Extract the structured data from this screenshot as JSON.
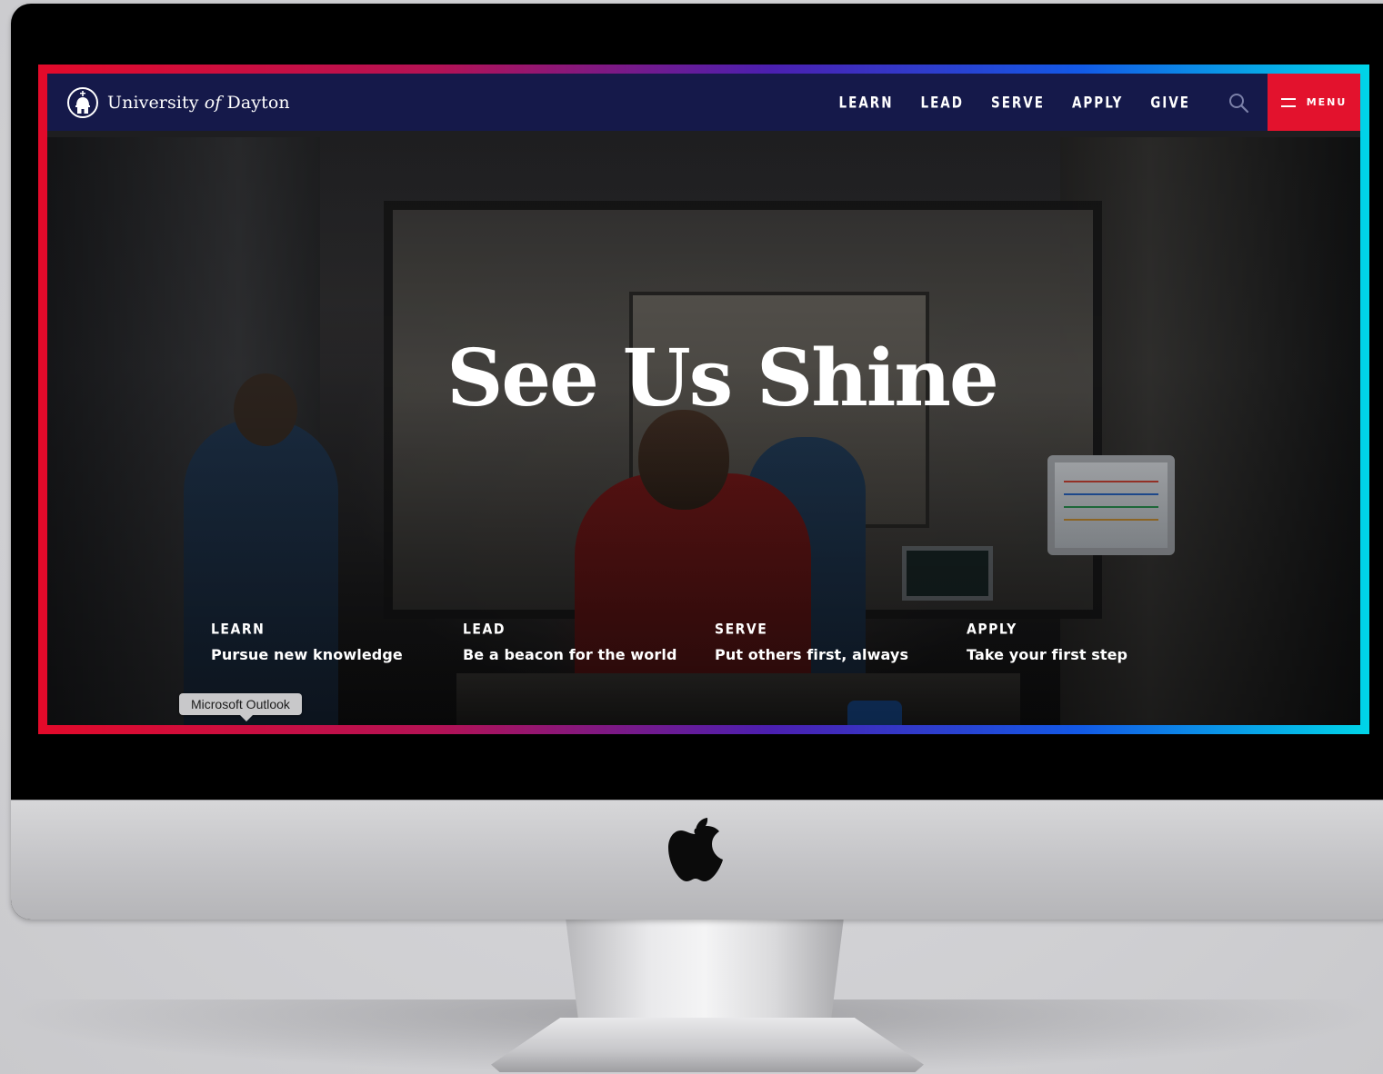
{
  "brand": {
    "name_prefix": "University",
    "name_italic": "of",
    "name_suffix": "Dayton",
    "seal_icon": "chapel-dome-seal-icon"
  },
  "nav": {
    "links": [
      "LEARN",
      "LEAD",
      "SERVE",
      "APPLY",
      "GIVE"
    ],
    "search_icon": "search-icon",
    "menu_label": "MENU",
    "menu_icon": "hamburger-icon"
  },
  "hero": {
    "title": "See Us Shine"
  },
  "pillars": [
    {
      "label": "LEARN",
      "description": "Pursue new knowledge"
    },
    {
      "label": "LEAD",
      "description": "Be a beacon for the world"
    },
    {
      "label": "SERVE",
      "description": "Put others first, always"
    },
    {
      "label": "APPLY",
      "description": "Take your first step"
    }
  ],
  "tooltip": {
    "text": "Microsoft Outlook"
  },
  "colors": {
    "navbar": "#15194a",
    "menu_button": "#e3122d",
    "frame_gradient_start": "#e30a2a",
    "frame_gradient_end": "#00d5e8"
  },
  "device": {
    "logo_icon": "apple-logo-icon"
  }
}
